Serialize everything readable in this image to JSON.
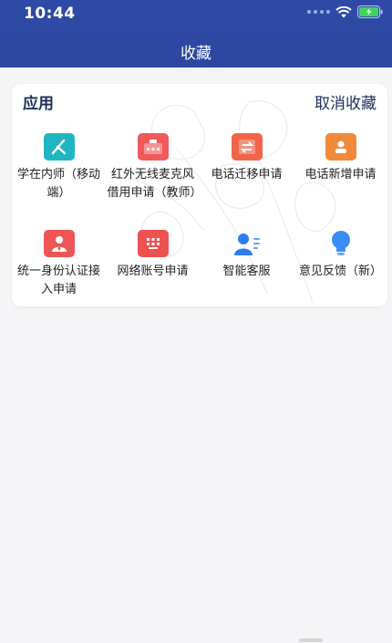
{
  "status_bar": {
    "time": "10:44"
  },
  "header": {
    "title": "收藏"
  },
  "section": {
    "title": "应用",
    "action": "取消收藏"
  },
  "apps": [
    {
      "label": "学在内师（移动端）",
      "icon": "pen-icon",
      "color": "#1fb6c4"
    },
    {
      "label": "红外无线麦克风借用申请（教师）",
      "icon": "box-icon",
      "color": "#f05a5a"
    },
    {
      "label": "电话迁移申请",
      "icon": "transfer-icon",
      "color": "#f2644a"
    },
    {
      "label": "电话新增申请",
      "icon": "contact-card-icon",
      "color": "#f08a3a"
    },
    {
      "label": "统一身份认证接入申请",
      "icon": "person-icon",
      "color": "#ef5555"
    },
    {
      "label": "网络账号申请",
      "icon": "grid-icon",
      "color": "#ef5050"
    },
    {
      "label": "智能客服",
      "icon": "service-icon",
      "color": "#2d7cf0"
    },
    {
      "label": "意见反馈（新）",
      "icon": "bulb-icon",
      "color": "#3a8df5"
    }
  ]
}
